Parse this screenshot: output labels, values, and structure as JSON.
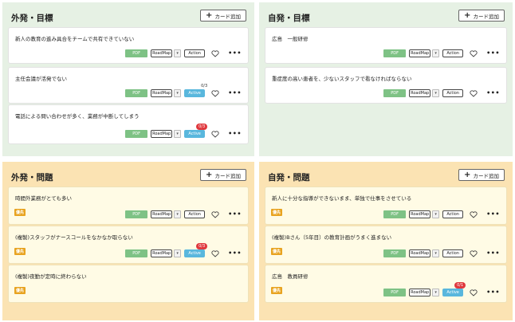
{
  "quadrants": [
    {
      "title": "外発・目標",
      "add_label": "カード追加",
      "cards": [
        {
          "text": "新人の教育の進み具合をチームで共有できていない",
          "tag": "",
          "pdf": "PDF",
          "roadmap": "RoadMap",
          "action": "Action",
          "active": false,
          "count": ""
        },
        {
          "text": "主任会議が活発でない",
          "tag": "",
          "pdf": "PDF",
          "roadmap": "RoadMap",
          "action": "Active",
          "active": true,
          "count": "0/3"
        },
        {
          "text": "電話による問い合わせが多く、業務が中断してしまう",
          "tag": "",
          "pdf": "PDF",
          "roadmap": "RoadMap",
          "action": "Active",
          "active": true,
          "count": "0/3"
        }
      ]
    },
    {
      "title": "自発・目標",
      "add_label": "カード追加",
      "cards": [
        {
          "text": "広島　一般研修",
          "tag": "",
          "pdf": "PDF",
          "roadmap": "RoadMap",
          "action": "Action",
          "active": false,
          "count": ""
        },
        {
          "text": "重症度の高い患者を、少ないスタッフで看なければならない",
          "tag": "",
          "pdf": "PDF",
          "roadmap": "RoadMap",
          "action": "Action",
          "active": false,
          "count": ""
        }
      ]
    },
    {
      "title": "外発・問題",
      "add_label": "カード追加",
      "cards": [
        {
          "text": "時間外業務がとても多い",
          "tag": "優先",
          "pdf": "PDF",
          "roadmap": "RoadMap",
          "action": "Action",
          "active": false,
          "count": ""
        },
        {
          "text": "(複製)スタッフがナースコールをなかなか取らない",
          "tag": "優先",
          "pdf": "PDF",
          "roadmap": "RoadMap",
          "action": "Active",
          "active": true,
          "count": "0/3"
        },
        {
          "text": "(複製)夜勤が定時に終わらない",
          "tag": "優先",
          "pdf": "PDF",
          "roadmap": "RoadMap",
          "action": "Action",
          "active": false,
          "count": ""
        }
      ]
    },
    {
      "title": "自発・問題",
      "add_label": "カード追加",
      "cards": [
        {
          "text": "新人に十分な指導ができないまま、単独で仕事をさせている",
          "tag": "優先",
          "pdf": "PDF",
          "roadmap": "RoadMap",
          "action": "Action",
          "active": false,
          "count": ""
        },
        {
          "text": "(複製)Bさん（5年目）の教育計画がうまく進まない",
          "tag": "優先",
          "pdf": "PDF",
          "roadmap": "RoadMap",
          "action": "Action",
          "active": false,
          "count": ""
        },
        {
          "text": "広島　教員研修",
          "tag": "優先",
          "pdf": "PDF",
          "roadmap": "RoadMap",
          "action": "Active",
          "active": true,
          "count": "0/1"
        }
      ]
    }
  ],
  "colors": {
    "goal_bg": "#e6f1e4",
    "problem_bg": "#fbe3b3",
    "pdf": "#7ec285",
    "active": "#59b7dd",
    "badge": "#e0383d",
    "tag": "#e8a320"
  },
  "icons": {
    "add": "plus-icon",
    "like": "heart-icon",
    "menu": "more-dots-icon",
    "dropdown": "chevron-down-icon"
  }
}
